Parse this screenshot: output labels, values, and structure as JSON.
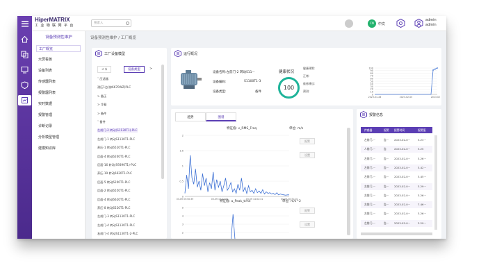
{
  "app": {
    "brand": "HiperMATRIX",
    "brand_sub": "工 业 物 联 网 平 台"
  },
  "topbar": {
    "search_placeholder": "搜索入",
    "lang_badge": "CN",
    "lang": "中文",
    "user_name": "admin",
    "user_role": "admin"
  },
  "sidebar": {
    "title": "设备预测性维护",
    "items": [
      {
        "label": "工厂概览",
        "active": true
      },
      {
        "label": "大屏看板"
      },
      {
        "label": "设备列表"
      },
      {
        "label": "传感器列表"
      },
      {
        "label": "报警器列表"
      },
      {
        "label": "实时数据"
      },
      {
        "label": "报警管理"
      },
      {
        "label": "诊断记录"
      },
      {
        "label": "分析模型管理"
      },
      {
        "label": "建模知识库"
      }
    ]
  },
  "breadcrumb": {
    "parent": "设备预测性维护",
    "sep": "/",
    "current": "工厂概览"
  },
  "tree": {
    "title": "工厂设备模型",
    "tab_left": "< $",
    "tab_active": "设备类型",
    "tab_arrow": ">",
    "rows": [
      {
        "text": "˅  压滤器"
      },
      {
        "text": "     测压1台(修6670WZ)PLC"
      },
      {
        "text": ">  备压"
      },
      {
        "text": ">  冷凝"
      },
      {
        "text": ">  备件"
      },
      {
        "text": "˅  备件"
      },
      {
        "text": "     左前门-2 转动(S1130T1)-PLC",
        "sel": true
      },
      {
        "text": "     左前门-1 转动S1130T1-PLC"
      },
      {
        "text": "     养压-1 转动6520T1-PLC"
      },
      {
        "text": "     后面-4 转动6200T1-PLC"
      },
      {
        "text": "     后面-16 转动(S9390T1)-PLC"
      },
      {
        "text": "     养压-19 转动6620T1-PLC"
      },
      {
        "text": "     后面-5 转动6200T1-PLC"
      },
      {
        "text": "     后面-2 转动6550T1-PLC"
      },
      {
        "text": "     后面-4 转动6620T1-PLC"
      },
      {
        "text": "     养压-8 转动6520T1-PLC"
      },
      {
        "text": "     左前门-3 转动S1130T1-PLC"
      },
      {
        "text": "     左前门-4 转动S1130T1-PLC"
      },
      {
        "text": "     右前门-4 转动S1130T1-2-PLC"
      }
    ]
  },
  "status": {
    "title": "运行概况",
    "device_name_label": "设备名称:",
    "device_name": "左前门-2 转动S11···",
    "device_code_label": "设备编码:",
    "device_code": "S1100T1-3",
    "device_type_label": "设备类型:",
    "device_type": "备件",
    "health_title": "健康状况",
    "health_score": "100",
    "health_items": [
      "健康预警:",
      "正常:",
      "维修建议:",
      "预测:"
    ],
    "mini_chart": {
      "type": "line",
      "y_ticks": [
        "0",
        "10",
        "20",
        "30",
        "40",
        "50",
        "60",
        "70",
        "80",
        "90",
        "100"
      ],
      "x_ticks": [
        "2023-01-28",
        "2023-02-03",
        "2023-02-07"
      ],
      "values": [
        0,
        0,
        0,
        0,
        0,
        0,
        0,
        0,
        0,
        0,
        0,
        0,
        0,
        0,
        0,
        0,
        0,
        0,
        0,
        0,
        0,
        0,
        0,
        0,
        0,
        0,
        0,
        0,
        92,
        96,
        100
      ]
    }
  },
  "trend": {
    "tabs": [
      "趋势",
      "图谱"
    ],
    "active_tab": 1,
    "plot1": {
      "label_feature": "特征值:",
      "feature": "v_RMS_Freq",
      "label_unit": "单位:",
      "unit": "m/s"
    },
    "plot2": {
      "label_feature": "特征值:",
      "feature": "a_Peak_time",
      "label_unit": "单位:",
      "unit": "m/s^2"
    },
    "side_buttons": [
      "报警",
      "设置",
      "报警",
      "设置"
    ]
  },
  "chart_data": [
    {
      "type": "line",
      "title": "",
      "y_ticks": [
        "0",
        "0.5",
        "1",
        "1.5",
        "2"
      ],
      "ylim": [
        0,
        2
      ],
      "x_ticks": [
        "03-09 05:50:39",
        "03-09 13:42:00",
        "03-09 14:02:41",
        "03-09 20:31:10"
      ],
      "values": [
        0.1,
        0.7,
        0.25,
        1.35,
        0.6,
        0.4,
        0.9,
        0.3,
        0.5,
        0.2,
        0.75,
        0.35,
        0.6,
        0.15,
        0.45,
        0.25,
        0.8,
        0.2,
        0.55,
        0.3,
        0.5,
        0.15,
        0.35,
        0.6,
        0.2,
        0.3,
        0.45,
        0.15,
        0.25,
        0.1,
        0.4,
        0.2,
        0.6,
        0.15,
        0.3,
        0.1,
        0.35,
        0.15,
        0.2,
        0.1,
        0.25,
        0.12,
        0.18,
        0.1,
        0.22,
        0.08,
        0.15,
        0.1,
        0.12,
        0.08,
        0.1,
        0.06,
        0.12,
        0.05,
        0.08,
        0.06,
        0.05,
        0.04,
        0.05,
        0.05
      ]
    },
    {
      "type": "line",
      "title": "",
      "y_ticks": [
        "0",
        "1",
        "2",
        "3",
        "4",
        "5"
      ],
      "ylim": [
        0,
        5
      ],
      "values": [
        0,
        0,
        0,
        0,
        0,
        0,
        0,
        0,
        0,
        0,
        0,
        0,
        0,
        0,
        0,
        0,
        0,
        0,
        4.2,
        0,
        0,
        0,
        0,
        0,
        0,
        0,
        0,
        0,
        0,
        0,
        0,
        0,
        0,
        0,
        0,
        0,
        0,
        0,
        0,
        0
      ]
    }
  ],
  "alarm": {
    "title": "报警信息",
    "headers": [
      "传感器",
      "报警",
      "报警时间",
      "报警值"
    ],
    "rows": [
      [
        "左前门-···",
        "告···",
        "2023-02-0···",
        "3.23···"
      ],
      [
        "人前门-···",
        "告",
        "2023-02-0···",
        "3.25"
      ],
      [
        "左前门-···",
        "告···",
        "2023-02-0···",
        "3.26···"
      ],
      [
        "左前门-···",
        "告···",
        "2023-02-0···",
        "3.42···"
      ],
      [
        "左前门-···",
        "告···",
        "2023-02-0···",
        "3.45···"
      ],
      [
        "左前门-···",
        "告···",
        "2023-02-0···",
        "3.29···"
      ],
      [
        "左前门-···",
        "告···",
        "2023-02-0···",
        "3.26···"
      ],
      [
        "左前门-···",
        "告···",
        "2023-02-0···",
        "7.46···"
      ],
      [
        "左前门-···",
        "告···",
        "2023-02-0···",
        "3.26···"
      ],
      [
        "左前门-···",
        "告···",
        "2023-02-0···",
        "3.29···"
      ]
    ]
  }
}
